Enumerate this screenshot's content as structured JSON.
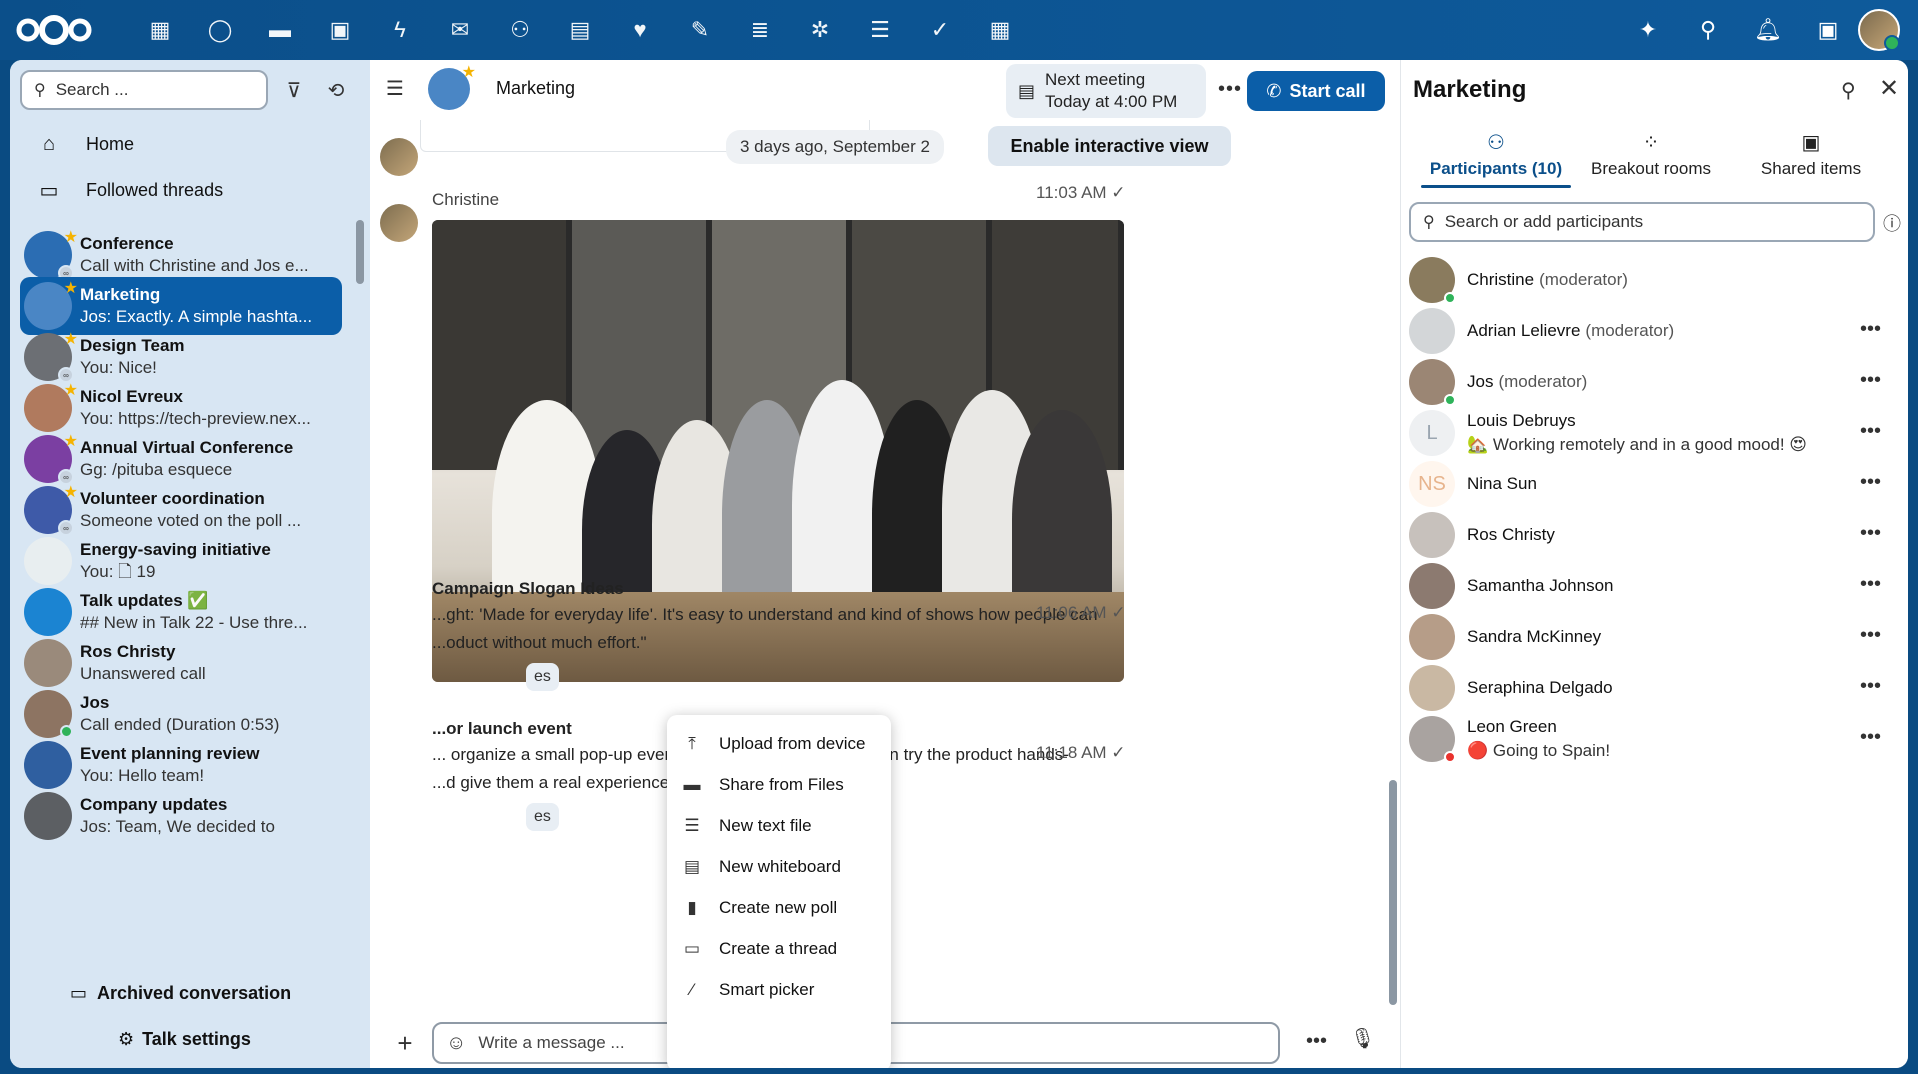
{
  "topbar": {
    "apps": [
      {
        "name": "dashboard-icon",
        "glyph": "▦"
      },
      {
        "name": "talk-icon",
        "glyph": "◯"
      },
      {
        "name": "files-icon",
        "glyph": "▬"
      },
      {
        "name": "photos-icon",
        "glyph": "▣"
      },
      {
        "name": "activity-icon",
        "glyph": "ϟ"
      },
      {
        "name": "mail-icon",
        "glyph": "✉"
      },
      {
        "name": "contacts-icon",
        "glyph": "⚇"
      },
      {
        "name": "calendar-icon",
        "glyph": "▤"
      },
      {
        "name": "health-icon",
        "glyph": "♥"
      },
      {
        "name": "notes-icon",
        "glyph": "✎"
      },
      {
        "name": "deck-icon",
        "glyph": "≣"
      },
      {
        "name": "ai-assistant-icon",
        "glyph": "✲"
      },
      {
        "name": "list-icon",
        "glyph": "☰"
      },
      {
        "name": "tasks-icon",
        "glyph": "✓"
      },
      {
        "name": "tables-icon",
        "glyph": "▦"
      }
    ]
  },
  "sidebar": {
    "search_placeholder": "Search ...",
    "home": "Home",
    "followed": "Followed threads",
    "conversations": [
      {
        "name": "Conference",
        "last": "Call with Christine and Jos e...",
        "color": "#2b6db3",
        "star": true,
        "badge": true
      },
      {
        "name": "Marketing",
        "last": "Jos: Exactly. A simple hashta...",
        "color": "#4a86c5",
        "star": true,
        "badge": false
      },
      {
        "name": "Design Team",
        "last": "You: Nice!",
        "color": "#6c6f74",
        "star": true,
        "badge": true
      },
      {
        "name": "Nicol Evreux",
        "last": "You: https://tech-preview.nex...",
        "color": "#b07a5e",
        "star": true,
        "badge": false
      },
      {
        "name": "Annual Virtual Conference",
        "last": "Gg: /pituba esquece",
        "color": "#7b3fa2",
        "star": true,
        "badge": true
      },
      {
        "name": "Volunteer coordination",
        "last": "Someone voted on the poll ...",
        "color": "#3e5aa8",
        "star": true,
        "badge": true
      },
      {
        "name": "Energy-saving initiative",
        "last": "You: 🗋 19",
        "color": "#e8eef0",
        "star": false,
        "badge": false
      },
      {
        "name": "Talk updates ✅",
        "last": "## New in Talk 22 - Use thre...",
        "color": "#1b84d2",
        "star": false,
        "badge": false
      },
      {
        "name": "Ros Christy",
        "last": "Unanswered call",
        "color": "#9a8a7b",
        "star": false,
        "badge": false
      },
      {
        "name": "Jos",
        "last": "Call ended (Duration 0:53)",
        "color": "#8d7462",
        "star": false,
        "badge": false,
        "online": true
      },
      {
        "name": "Event planning review",
        "last": "You: Hello team!",
        "color": "#2f5fa0",
        "star": false,
        "badge": false
      },
      {
        "name": "Company updates",
        "last": "Jos: Team, We decided to",
        "color": "#5c5f63",
        "star": false,
        "badge": false
      }
    ],
    "archived": "Archived conversation",
    "settings": "Talk settings"
  },
  "chat": {
    "title": "Marketing",
    "next_meeting_label": "Next meeting",
    "next_meeting_time": "Today at 4:00 PM",
    "start_call": "Start call",
    "date_separator": "3 days ago, September 2",
    "interactive": "Enable interactive view",
    "author": "Christine",
    "photo_time": "11:03 AM ✓",
    "messages": [
      {
        "title": "Campaign Slogan Ideas",
        "text1": "...ght: 'Made for everyday life'. It's easy to understand and kind of shows how people can",
        "text2": "...oduct without much effort.\"",
        "chip": "es",
        "time": "11:06 AM ✓"
      },
      {
        "title": "...or launch event",
        "text1": "... organize a small pop-up event downtown where people can try the product hands-",
        "text2": "...d give them a real experience instead of just seeing ads.",
        "chip": "es",
        "time": "11:18 AM ✓"
      }
    ],
    "composer_placeholder": "Write a message ...",
    "menu": [
      {
        "label": "Upload from device",
        "icon": "⤒"
      },
      {
        "label": "Share from Files",
        "icon": "▬"
      },
      {
        "label": "New text file",
        "icon": "☰"
      },
      {
        "label": "New whiteboard",
        "icon": "▤"
      },
      {
        "label": "Create new poll",
        "icon": "▮"
      },
      {
        "label": "Create a thread",
        "icon": "▭"
      },
      {
        "label": "Smart picker",
        "icon": "⁄"
      }
    ]
  },
  "right": {
    "title": "Marketing",
    "tabs": [
      "Participants (10)",
      "Breakout rooms",
      "Shared items"
    ],
    "search_placeholder": "Search or add participants",
    "participants": [
      {
        "name": "Christine",
        "role": "(moderator)",
        "status": "",
        "color": "#8a7b5e",
        "dot": "#2fb35a",
        "dots": false
      },
      {
        "name": "Adrian Lelievre",
        "role": "(moderator)",
        "status": "",
        "color": "#d3d6d8",
        "dot": "",
        "dots": true
      },
      {
        "name": "Jos",
        "role": "(moderator)",
        "status": "",
        "color": "#9b8674",
        "dot": "#2fb35a",
        "dots": true
      },
      {
        "name": "Louis Debruys",
        "role": "",
        "status": "🏡 Working remotely and in a good mood! 😍",
        "color": "#eef0f2",
        "initial": "L",
        "dot": "",
        "dots": true
      },
      {
        "name": "Nina Sun",
        "role": "",
        "status": "",
        "color": "#fff6ee",
        "initial": "NS",
        "dot": "",
        "dots": true
      },
      {
        "name": "Ros Christy",
        "role": "",
        "status": "",
        "color": "#c7c1bc",
        "dot": "",
        "dots": true
      },
      {
        "name": "Samantha Johnson",
        "role": "",
        "status": "",
        "color": "#8c7a70",
        "dot": "",
        "dots": true
      },
      {
        "name": "Sandra McKinney",
        "role": "",
        "status": "",
        "color": "#b69d88",
        "dot": "",
        "dots": true
      },
      {
        "name": "Seraphina Delgado",
        "role": "",
        "status": "",
        "color": "#c9b8a3",
        "dot": "",
        "dots": true
      },
      {
        "name": "Leon Green",
        "role": "",
        "status": "🔴 Going to Spain!",
        "color": "#a9a3a0",
        "dot": "#e9322d",
        "dots": true
      }
    ]
  }
}
